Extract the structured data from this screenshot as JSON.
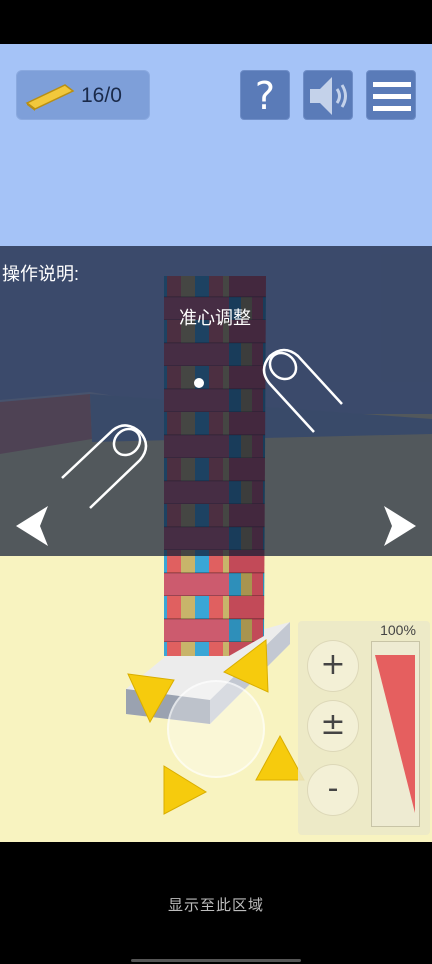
{
  "hud": {
    "block_count": "16/0",
    "help_label": "?",
    "icons": {
      "block": "wooden-block-icon",
      "help": "question-icon",
      "sound": "speaker-icon",
      "menu": "hamburger-menu-icon"
    }
  },
  "tutorial": {
    "title": "操作说明:",
    "aim_label": "准心调整",
    "swipe_left_icon": "left-swipe-hand-icon",
    "swipe_right_icon": "right-swipe-hand-icon"
  },
  "navigation": {
    "left_arrow_icon": "chevron-left-icon",
    "right_arrow_icon": "chevron-right-icon"
  },
  "zoom": {
    "percent": "100%",
    "plus_label": "+",
    "reset_label": "±",
    "minus_label": "-"
  },
  "footer": {
    "text": "显示至此区域"
  },
  "colors": {
    "sky": "#a5c3f7",
    "floor": "#f8f3c0",
    "hud_button": "#5a7bb8",
    "arrow_yellow": "#f6cb0d",
    "gauge_fill": "#e55f5f"
  }
}
